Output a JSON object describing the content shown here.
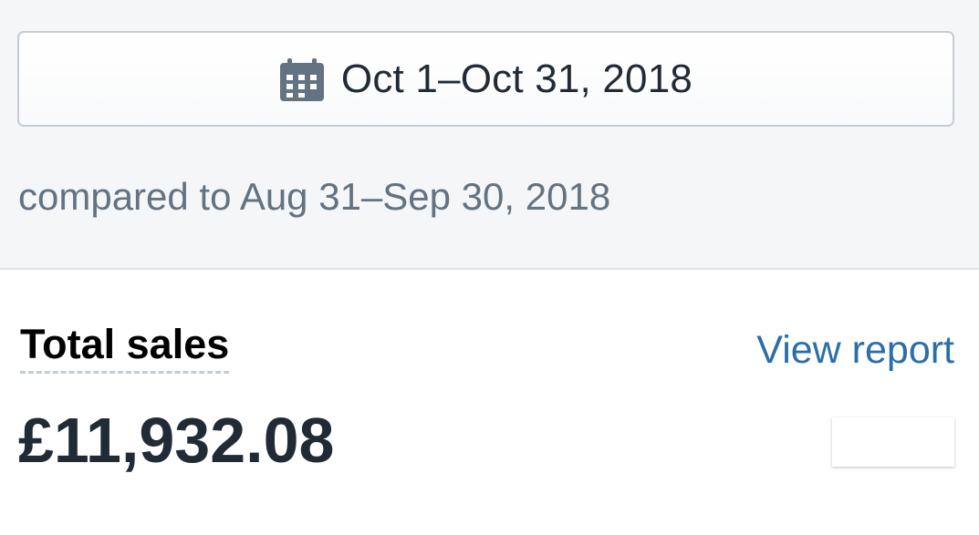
{
  "date_picker": {
    "range_label": "Oct 1–Oct 31, 2018",
    "icon": "calendar-icon"
  },
  "comparison": {
    "text": "compared to Aug 31–Sep 30, 2018"
  },
  "metric": {
    "title": "Total sales",
    "view_report_label": "View report",
    "value": "£11,932.08"
  },
  "colors": {
    "link": "#2b6fa8",
    "text_primary": "#212b36",
    "text_secondary": "#637381",
    "background_top": "#f4f6f8",
    "icon": "#637381"
  }
}
